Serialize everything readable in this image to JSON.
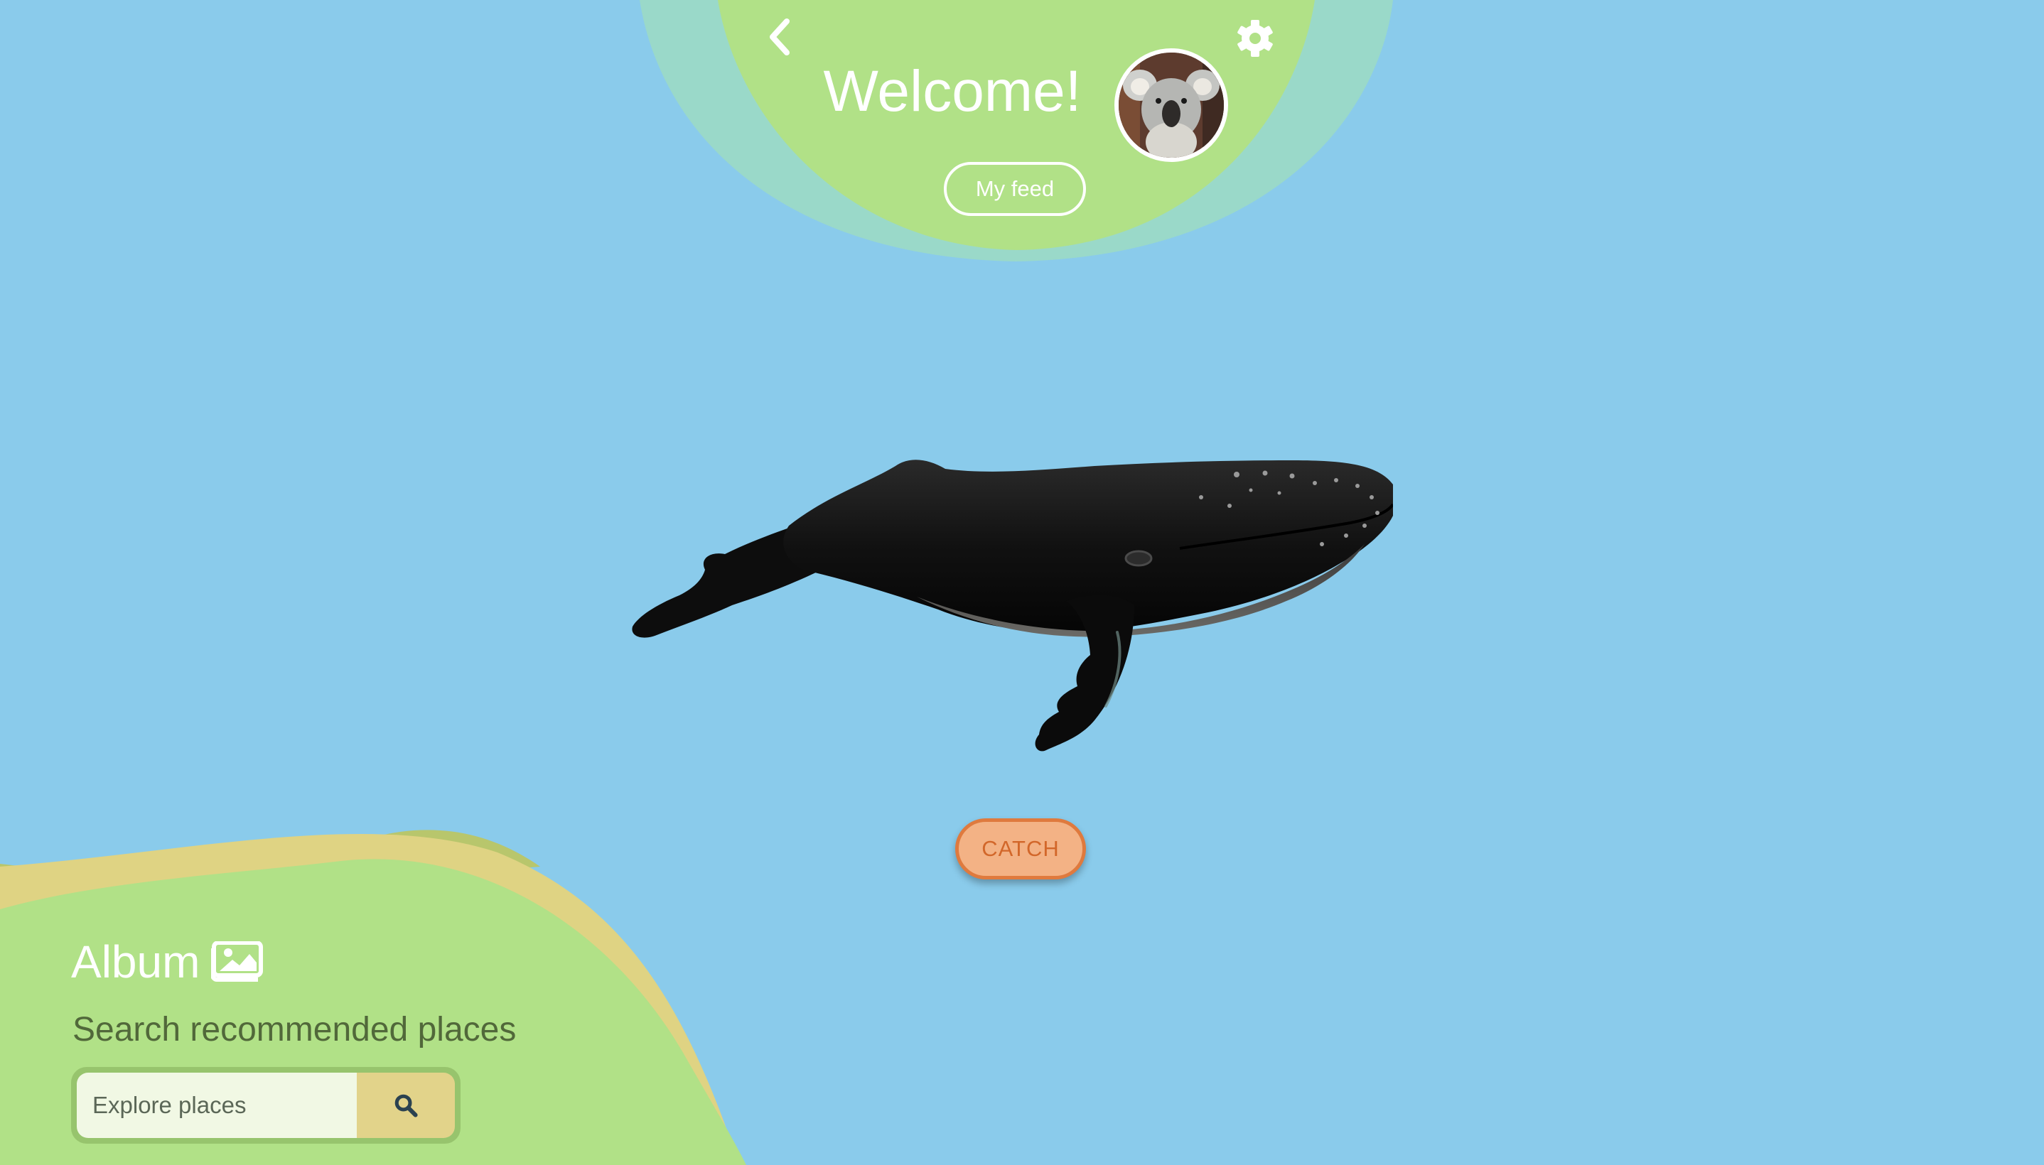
{
  "header": {
    "title": "Welcome!",
    "feed_button_label": "My feed",
    "back_icon": "chevron-left-icon",
    "settings_icon": "gear-icon",
    "avatar_subject": "koala"
  },
  "main": {
    "creature": "humpback whale",
    "catch_button_label": "CATCH"
  },
  "album": {
    "title": "Album",
    "icon": "images-icon",
    "search_caption": "Search recommended places",
    "search_placeholder": "Explore places",
    "search_icon": "search-icon"
  },
  "colors": {
    "sky": "#8acbeb",
    "green": "#b1e187",
    "teal": "#9ad9c9",
    "sand": "#dfd383",
    "catch_fill": "#f3b285",
    "catch_border": "#df7a3e",
    "catch_text": "#d2672a",
    "search_button": "#e2d38a"
  }
}
